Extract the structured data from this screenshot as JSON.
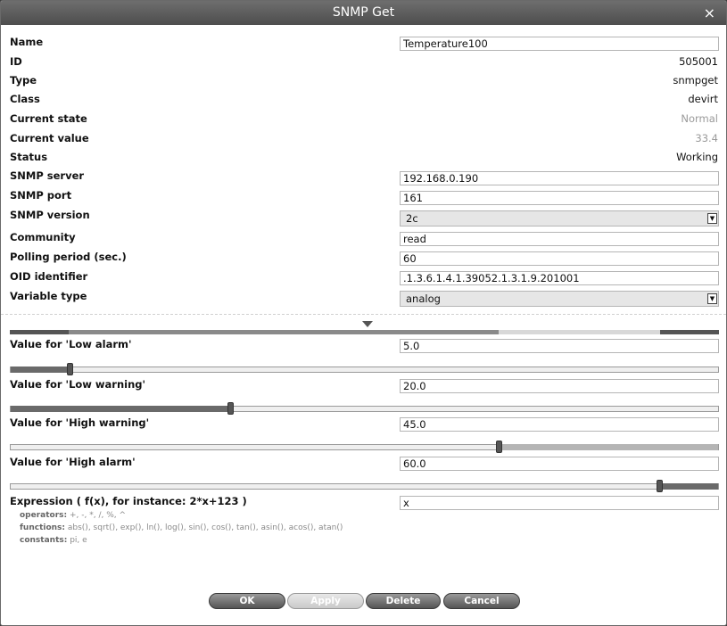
{
  "window": {
    "title": "SNMP Get",
    "close_icon": "×"
  },
  "fields": {
    "name": {
      "label": "Name",
      "value": "Temperature100"
    },
    "id": {
      "label": "ID",
      "value": "505001"
    },
    "type": {
      "label": "Type",
      "value": "snmpget"
    },
    "class": {
      "label": "Class",
      "value": "devirt"
    },
    "current_state": {
      "label": "Current state",
      "value": "Normal"
    },
    "current_value": {
      "label": "Current value",
      "value": "33.4"
    },
    "status": {
      "label": "Status",
      "value": "Working"
    },
    "snmp_server": {
      "label": "SNMP server",
      "value": "192.168.0.190"
    },
    "snmp_port": {
      "label": "SNMP port",
      "value": "161"
    },
    "snmp_version": {
      "label": "SNMP version",
      "value": "2c"
    },
    "community": {
      "label": "Community",
      "value": "read"
    },
    "polling_period": {
      "label": "Polling period (sec.)",
      "value": "60"
    },
    "oid": {
      "label": "OID identifier",
      "value": ".1.3.6.1.4.1.39052.1.3.1.9.201001"
    },
    "variable_type": {
      "label": "Variable type",
      "value": "analog"
    }
  },
  "thresholds": {
    "low_alarm": {
      "label": "Value for 'Low alarm'",
      "value": "5.0",
      "slider_fraction": 0.083
    },
    "low_warning": {
      "label": "Value for 'Low warning'",
      "value": "20.0",
      "slider_fraction": 0.31
    },
    "high_warning": {
      "label": "Value for 'High warning'",
      "value": "45.0",
      "slider_fraction": 0.69
    },
    "high_alarm": {
      "label": "Value for 'High alarm'",
      "value": "60.0",
      "slider_fraction": 0.917
    }
  },
  "expression": {
    "label": "Expression ( f(x), for instance: 2*x+123 )",
    "value": "x",
    "operators_label": "operators:",
    "operators": "+, -, *, /, %, ^",
    "functions_label": "functions:",
    "functions": "abs(), sqrt(), exp(), ln(), log(), sin(), cos(), tan(), asin(), acos(), atan()",
    "constants_label": "constants:",
    "constants": "pi, e"
  },
  "buttons": {
    "ok": "OK",
    "apply": "Apply",
    "delete": "Delete",
    "cancel": "Cancel"
  },
  "colors": {
    "titlebar": "#5a5a5a",
    "slider_fill": "#6a6a6a",
    "button": "#666666"
  }
}
